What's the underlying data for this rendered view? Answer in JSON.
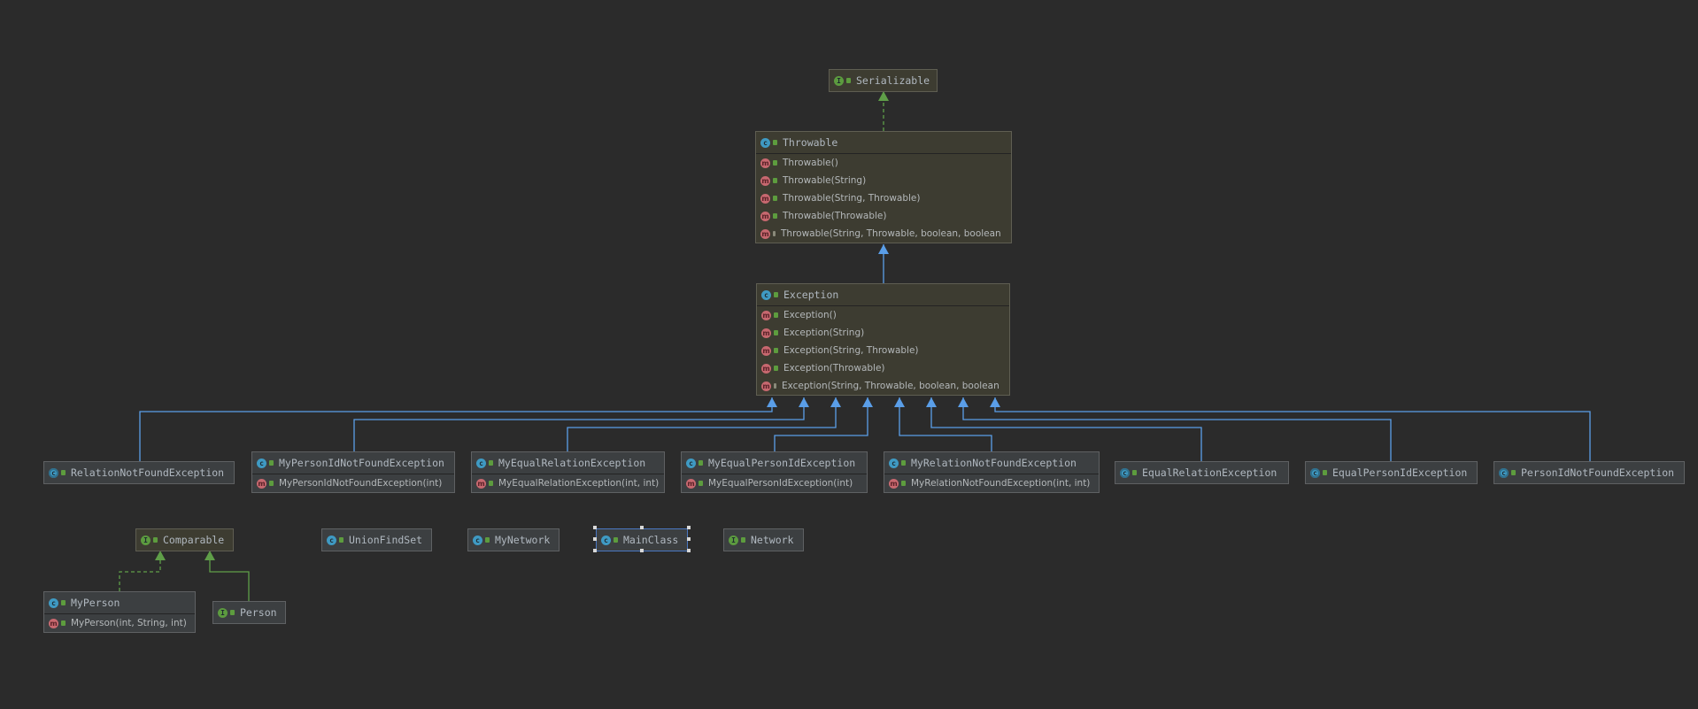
{
  "diagram": {
    "colors": {
      "background": "#2b2b2b",
      "inheritance_edge": "#5a9ee8",
      "implements_edge": "#5f9e48",
      "selection": "#4a78c2"
    },
    "nodes": [
      {
        "id": "Serializable",
        "name": "Serializable",
        "kind": "interface",
        "library": true,
        "methods": []
      },
      {
        "id": "Throwable",
        "name": "Throwable",
        "kind": "class",
        "library": true,
        "methods": [
          {
            "label": "Throwable()",
            "visibility": "public"
          },
          {
            "label": "Throwable(String)",
            "visibility": "public"
          },
          {
            "label": "Throwable(String, Throwable)",
            "visibility": "public"
          },
          {
            "label": "Throwable(Throwable)",
            "visibility": "public"
          },
          {
            "label": "Throwable(String, Throwable, boolean, boolean",
            "visibility": "protected"
          }
        ]
      },
      {
        "id": "Exception",
        "name": "Exception",
        "kind": "class",
        "library": true,
        "methods": [
          {
            "label": "Exception()",
            "visibility": "public"
          },
          {
            "label": "Exception(String)",
            "visibility": "public"
          },
          {
            "label": "Exception(String, Throwable)",
            "visibility": "public"
          },
          {
            "label": "Exception(Throwable)",
            "visibility": "public"
          },
          {
            "label": "Exception(String, Throwable, boolean, boolean",
            "visibility": "protected"
          }
        ]
      },
      {
        "id": "RelationNotFoundException",
        "name": "RelationNotFoundException",
        "kind": "exception",
        "library": false,
        "methods": []
      },
      {
        "id": "MyPersonIdNotFoundException",
        "name": "MyPersonIdNotFoundException",
        "kind": "class",
        "library": false,
        "methods": [
          {
            "label": "MyPersonIdNotFoundException(int)",
            "visibility": "public"
          }
        ]
      },
      {
        "id": "MyEqualRelationException",
        "name": "MyEqualRelationException",
        "kind": "class",
        "library": false,
        "methods": [
          {
            "label": "MyEqualRelationException(int, int)",
            "visibility": "public"
          }
        ]
      },
      {
        "id": "MyEqualPersonIdException",
        "name": "MyEqualPersonIdException",
        "kind": "class",
        "library": false,
        "methods": [
          {
            "label": "MyEqualPersonIdException(int)",
            "visibility": "public"
          }
        ]
      },
      {
        "id": "MyRelationNotFoundException",
        "name": "MyRelationNotFoundException",
        "kind": "class",
        "library": false,
        "methods": [
          {
            "label": "MyRelationNotFoundException(int, int)",
            "visibility": "public"
          }
        ]
      },
      {
        "id": "EqualRelationException",
        "name": "EqualRelationException",
        "kind": "exception",
        "library": false,
        "methods": []
      },
      {
        "id": "EqualPersonIdException",
        "name": "EqualPersonIdException",
        "kind": "exception",
        "library": false,
        "methods": []
      },
      {
        "id": "PersonIdNotFoundException",
        "name": "PersonIdNotFoundException",
        "kind": "exception",
        "library": false,
        "methods": []
      },
      {
        "id": "Comparable",
        "name": "Comparable",
        "kind": "interface",
        "library": true,
        "methods": []
      },
      {
        "id": "UnionFindSet",
        "name": "UnionFindSet",
        "kind": "class",
        "library": false,
        "methods": []
      },
      {
        "id": "MyNetwork",
        "name": "MyNetwork",
        "kind": "class",
        "library": false,
        "methods": []
      },
      {
        "id": "MainClass",
        "name": "MainClass",
        "kind": "class",
        "library": false,
        "selected": true,
        "methods": []
      },
      {
        "id": "Network",
        "name": "Network",
        "kind": "interface",
        "library": false,
        "methods": []
      },
      {
        "id": "MyPerson",
        "name": "MyPerson",
        "kind": "class",
        "library": false,
        "methods": [
          {
            "label": "MyPerson(int, String, int)",
            "visibility": "public"
          }
        ]
      },
      {
        "id": "Person",
        "name": "Person",
        "kind": "interface",
        "library": false,
        "methods": []
      }
    ],
    "edges": [
      {
        "from": "Throwable",
        "to": "Serializable",
        "type": "implements"
      },
      {
        "from": "Exception",
        "to": "Throwable",
        "type": "extends"
      },
      {
        "from": "RelationNotFoundException",
        "to": "Exception",
        "type": "extends"
      },
      {
        "from": "MyPersonIdNotFoundException",
        "to": "Exception",
        "type": "extends"
      },
      {
        "from": "MyEqualRelationException",
        "to": "Exception",
        "type": "extends"
      },
      {
        "from": "MyEqualPersonIdException",
        "to": "Exception",
        "type": "extends"
      },
      {
        "from": "MyRelationNotFoundException",
        "to": "Exception",
        "type": "extends"
      },
      {
        "from": "EqualRelationException",
        "to": "Exception",
        "type": "extends"
      },
      {
        "from": "EqualPersonIdException",
        "to": "Exception",
        "type": "extends"
      },
      {
        "from": "PersonIdNotFoundException",
        "to": "Exception",
        "type": "extends"
      },
      {
        "from": "MyPerson",
        "to": "Comparable",
        "type": "implements"
      },
      {
        "from": "Person",
        "to": "Comparable",
        "type": "extends"
      }
    ]
  }
}
